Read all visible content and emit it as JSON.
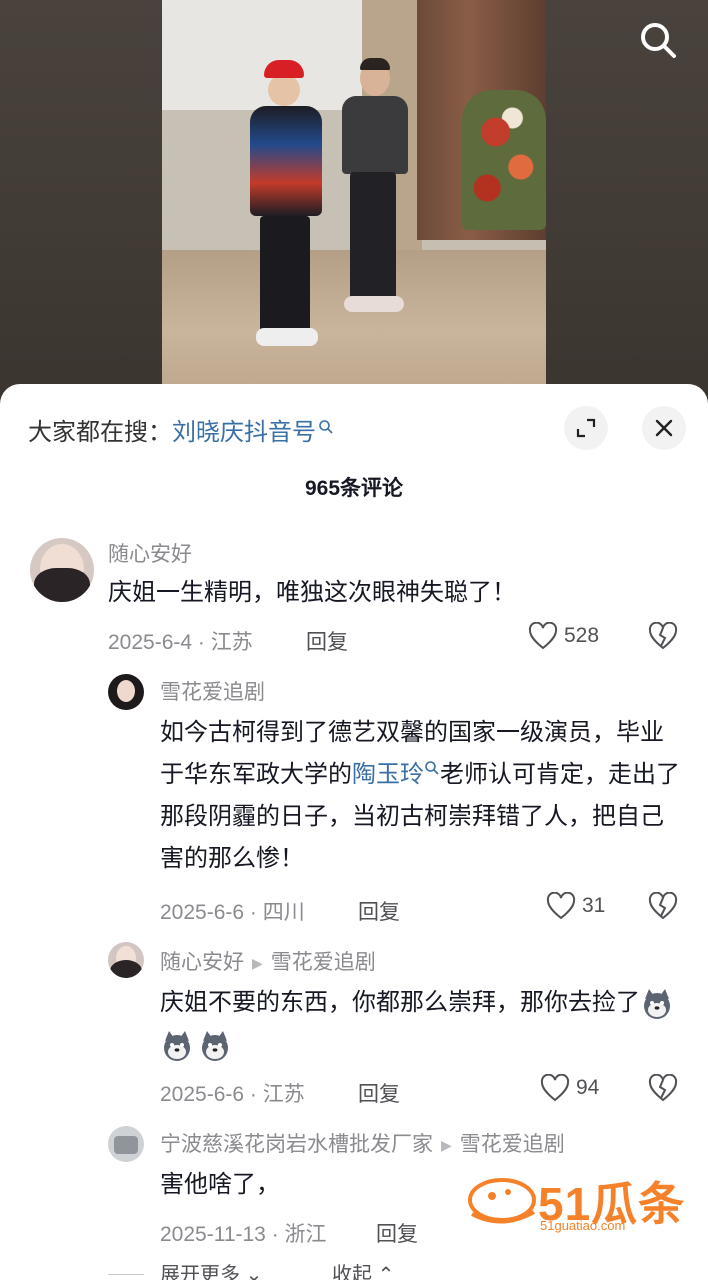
{
  "video": {
    "search_icon": "search-icon"
  },
  "sheet": {
    "hint_prefix": "大家都在搜：",
    "hint_keyword": "刘晓庆抖音号",
    "comment_count": "965条评论"
  },
  "comments": [
    {
      "author": "随心安好",
      "text": "庆姐一生精明，唯独这次眼神失聪了！",
      "date_location": "2025-6-4 · 江苏",
      "reply_label": "回复",
      "likes": "528"
    }
  ],
  "replies": [
    {
      "author": "雪花爱追剧",
      "text_before": "如今古柯得到了德艺双馨的国家一级演员，毕业于华东军政大学的",
      "text_link": "陶玉玲",
      "text_after": "老师认可肯定，走出了那段阴霾的日子，当初古柯崇拜错了人，把自己害的那么惨！",
      "date_location": "2025-6-6 · 四川",
      "reply_label": "回复",
      "likes": "31"
    },
    {
      "author": "随心安好",
      "reply_to": "雪花爱追剧",
      "text": "庆姐不要的东西，你都那么崇拜，那你去捡了",
      "date_location": "2025-6-6 · 江苏",
      "reply_label": "回复",
      "likes": "94"
    },
    {
      "author": "宁波慈溪花岗岩水槽批发厂家",
      "reply_to": "雪花爱追剧",
      "text": "害他啥了，",
      "date_location": "2025-11-13 · 浙江",
      "reply_label": "回复"
    }
  ],
  "footer": {
    "expand_more": "展开更多",
    "collapse": "收起"
  },
  "watermark": {
    "brand": "51瓜条",
    "url": "51guatiao.com"
  },
  "colors": {
    "link": "#3a6fa5",
    "watermark": "#f5822a"
  }
}
